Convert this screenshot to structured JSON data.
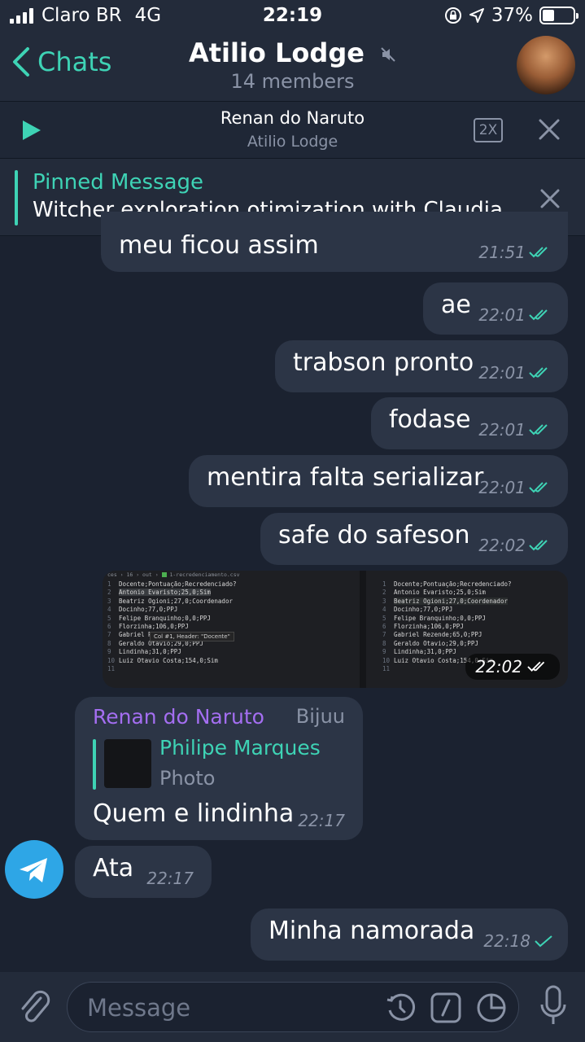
{
  "status_bar": {
    "carrier": "Claro BR",
    "network": "4G",
    "time": "22:19",
    "battery": "37%"
  },
  "header": {
    "back_label": "Chats",
    "chat_name": "Atilio Lodge",
    "members": "14 members"
  },
  "player": {
    "title": "Renan do Naruto",
    "subtitle": "Atilio Lodge",
    "speed": "2X"
  },
  "pinned": {
    "title": "Pinned Message",
    "text": "Witcher exploration otimization with Claudia..."
  },
  "messages": [
    {
      "text": "meu ficou assim",
      "time": "21:51"
    },
    {
      "text": "ae",
      "time": "22:01"
    },
    {
      "text": "trabson pronto",
      "time": "22:01"
    },
    {
      "text": "fodase",
      "time": "22:01"
    },
    {
      "text": "mentira falta serializar",
      "time": "22:01"
    },
    {
      "text": "safe do safeson",
      "time": "22:02"
    }
  ],
  "photo": {
    "time": "22:02",
    "lines_left": [
      "Docente;Pontuação;Recredenciado?",
      "Antonio Evaristo;25,0;Sim",
      "Beatriz Ogioni;27,0;Coordenador",
      "Docinho;77,0;PPJ",
      "Felipe Branquinho;0,0;PPJ",
      "Florzinha;106,0;PPJ",
      "Gabriel Rezende;65,0;PPJ",
      "Geraldo Otavio;29,0;PPJ",
      "Lindinha;31,0;PPJ",
      "Luiz Otavio Costa;154,0;Sim"
    ],
    "lines_right": [
      "Docente;Pontuação;Recredenciado?",
      "Antonio Evaristo;25,0;Sim",
      "Beatriz Ogioni;27,0;Coordenador",
      "Docinho;77,0;PPJ",
      "Felipe Branquinho;0,0;PPJ",
      "Florzinha;106,0;PPJ",
      "Gabriel Rezende;65,0;PPJ",
      "Geraldo Otavio;29,0;PPJ",
      "Lindinha;31,0;PPJ",
      "Luiz Otavio Costa;154,0;Sim"
    ],
    "tooltip": "Col #1, Header: \"Docente\"",
    "filename": "1-recredenciamento.csv"
  },
  "reply_message": {
    "sender": "Renan do Naruto",
    "role": "Bijuu",
    "quoted_name": "Philipe Marques",
    "quoted_type": "Photo",
    "text": "Quem e lindinha",
    "time": "22:17"
  },
  "incoming": {
    "text": "Ata",
    "time": "22:17"
  },
  "last_outgoing": {
    "text": "Minha namorada",
    "time": "22:18"
  },
  "input": {
    "placeholder": "Message"
  },
  "colors": {
    "accent": "#3ed3b5",
    "sender": "#a46ef1",
    "bubble": "#2c3546",
    "background": "#1b2230"
  }
}
